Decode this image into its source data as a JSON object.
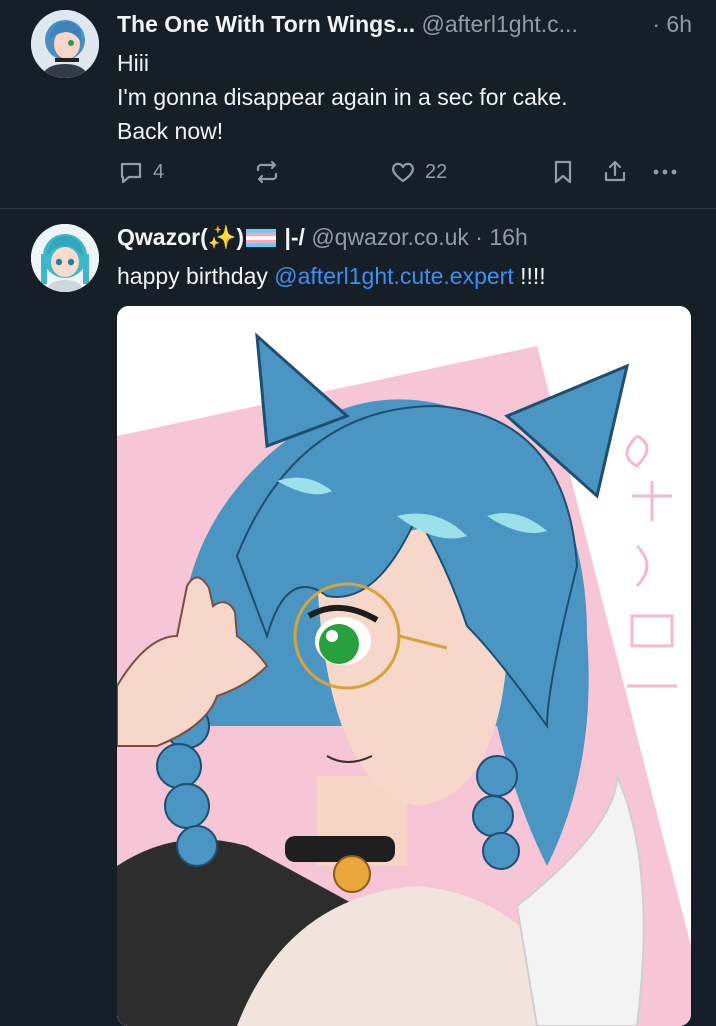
{
  "posts": [
    {
      "author_name": "The One With Torn Wings...",
      "handle": "@afterl1ght.c...",
      "time": "6h",
      "lines": [
        "Hiii",
        "I'm gonna disappear again in a sec for cake.",
        "Back now!"
      ],
      "reply_count": "4",
      "like_count": "22",
      "avatar_icon": "anime-avatar-blue-hair"
    },
    {
      "author_name_prefix": "Qwazor(",
      "sparkle_emoji": "✨",
      "author_name_suffix": ")",
      "name_tail": "|-/",
      "handle": "@qwazor.co.uk",
      "time": "16h",
      "text_before": "happy birthday ",
      "mention": "@afterl1ght.cute.expert",
      "text_after": " !!!!",
      "avatar_icon": "anime-avatar-teal-hair",
      "flag_icon": "trans-flag-icon"
    }
  ],
  "icons": {
    "reply": "speech-bubble-icon",
    "repost": "repost-arrows-icon",
    "like": "heart-icon",
    "bookmark": "bookmark-icon",
    "share": "share-upload-icon",
    "more": "ellipsis-icon"
  },
  "colors": {
    "background": "#161e27",
    "text": "#f1f3f5",
    "muted": "#8f9daa",
    "link": "#3b8ff5",
    "divider": "#2e3a47"
  }
}
